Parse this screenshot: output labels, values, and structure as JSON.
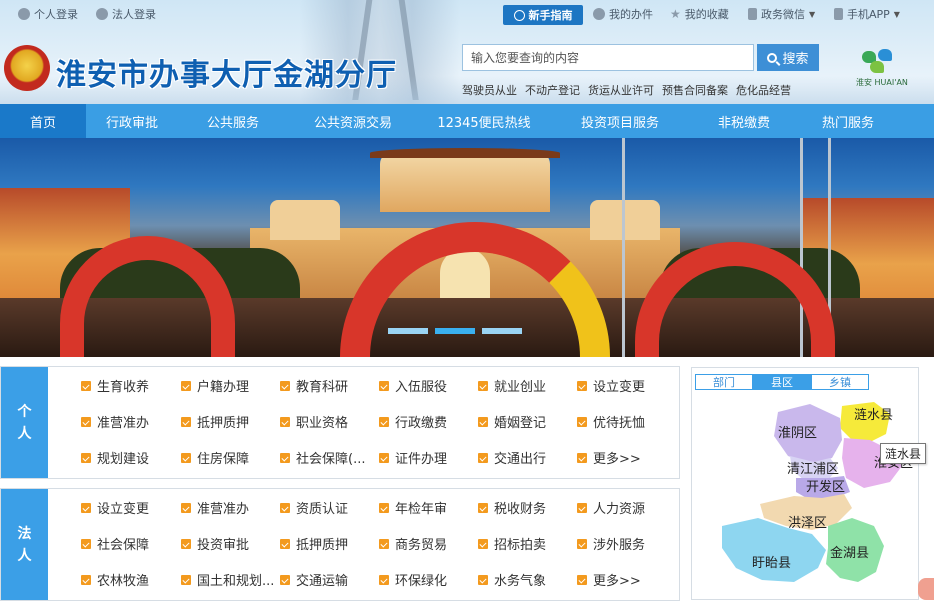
{
  "topbar": {
    "personal_login": "个人登录",
    "legal_login": "法人登录",
    "newbie_guide": "新手指南",
    "my_affairs": "我的办件",
    "my_favorites": "我的收藏",
    "wechat": "政务微信",
    "mobile_app": "手机APP"
  },
  "header": {
    "title": "淮安市办事大厅金湖分厅",
    "search_placeholder": "输入您要查询的内容",
    "search_button": "搜索",
    "hot_words": [
      "驾驶员从业",
      "不动产登记",
      "货运从业许可",
      "预售合同备案",
      "危化品经营"
    ],
    "logo_text": "淮安 HUAI'AN"
  },
  "nav": {
    "items": [
      "首页",
      "行政审批",
      "公共服务",
      "公共资源交易",
      "12345便民热线",
      "投资项目服务",
      "非税缴费",
      "热门服务"
    ],
    "active_index": 0
  },
  "banner": {
    "slides_total": 3,
    "active_slide": 1
  },
  "personal": {
    "label_1": "个",
    "label_2": "人",
    "items": [
      "生育收养",
      "户籍办理",
      "教育科研",
      "入伍服役",
      "就业创业",
      "设立变更",
      "准营准办",
      "抵押质押",
      "职业资格",
      "行政缴费",
      "婚姻登记",
      "优待抚恤",
      "规划建设",
      "住房保障",
      "社会保障(...",
      "证件办理",
      "交通出行",
      "更多>>"
    ]
  },
  "legal": {
    "label_1": "法",
    "label_2": "人",
    "items": [
      "设立变更",
      "准营准办",
      "资质认证",
      "年检年审",
      "税收财务",
      "人力资源",
      "社会保障",
      "投资审批",
      "抵押质押",
      "商务贸易",
      "招标拍卖",
      "涉外服务",
      "农林牧渔",
      "国土和规划...",
      "交通运输",
      "环保绿化",
      "水务气象",
      "更多>>"
    ]
  },
  "map": {
    "tabs": [
      "部门",
      "县区",
      "乡镇"
    ],
    "active_tab": 1,
    "counties": [
      "涟水县",
      "淮阴区",
      "淮安区",
      "清江浦区",
      "开发区",
      "洪泽区",
      "盱眙县",
      "金湖县"
    ],
    "tooltip": "涟水县"
  },
  "colors": {
    "brand_blue": "#0e5fb1",
    "nav_blue": "#3a9ee4",
    "nav_active": "#1a79c9",
    "accent_orange": "#f39a1e"
  }
}
